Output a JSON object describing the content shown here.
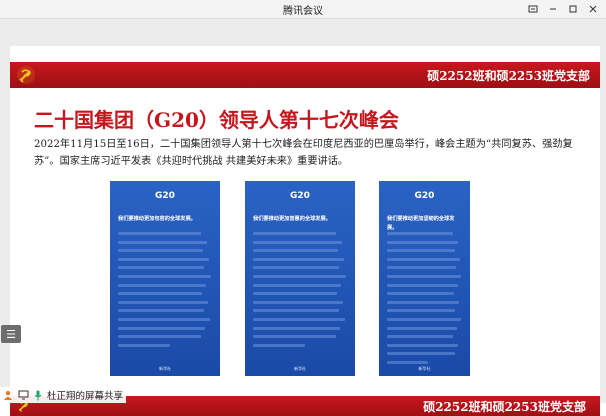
{
  "window": {
    "title": "腾讯会议",
    "controls": [
      "share-icon",
      "minimize-icon",
      "maximize-icon",
      "close-icon"
    ]
  },
  "slide": {
    "branch_label": "硕2252班和硕2253班党支部",
    "title": "二十国集团（G20）领导人第十七次峰会",
    "body": "2022年11月15日至16日，二十国集团领导人第十七次峰会在印度尼西亚的巴厘岛举行，峰会主题为“共同复苏、强劲复苏”。国家主席习近平发表《共迎时代挑战 共建美好未来》重要讲话。",
    "cards": [
      {
        "logo": "G20",
        "lead": "我们要推动更加包容的全球发展。",
        "line_count": 14,
        "brand": "新华社"
      },
      {
        "logo": "G20",
        "lead": "我们要推动更加普惠的全球发展。",
        "line_count": 14,
        "brand": "新华社"
      },
      {
        "logo": "G20",
        "lead": "我们要推动更加坚韧的全球发展。",
        "line_count": 16,
        "brand": "新华社"
      }
    ]
  },
  "sharing": {
    "presenter": "杜正翔的屏幕共享"
  },
  "colors": {
    "party_red": "#c4171d",
    "card_blue": "#2a63c4"
  }
}
